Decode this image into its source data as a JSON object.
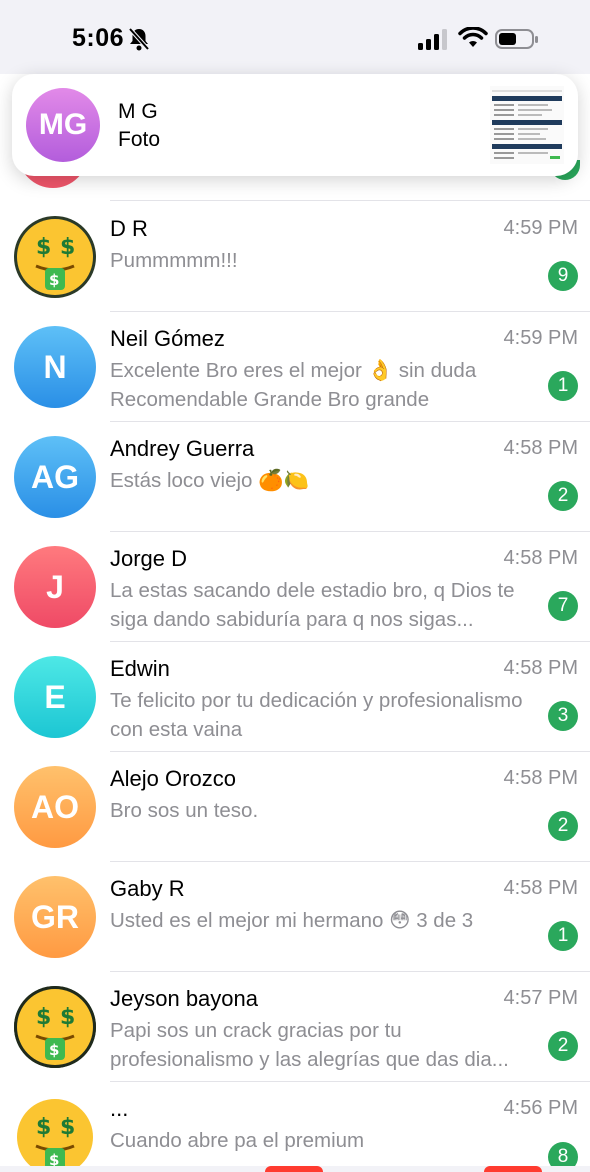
{
  "status_bar": {
    "time": "5:06"
  },
  "notification": {
    "avatar_initials": "MG",
    "sender": "M G",
    "text": "Foto"
  },
  "chats": [
    {
      "name": "D R",
      "time": "4:59 PM",
      "preview": "Pummmmm!!!",
      "unread": "9",
      "avatar_type": "emoji",
      "avatar_icon": "money-mouth-face-icon"
    },
    {
      "name": "Neil Gómez",
      "time": "4:59 PM",
      "preview": "Excelente Bro eres el mejor 👌 sin duda Recomendable Grande Bro grande",
      "unread": "1",
      "avatar_initials": "N",
      "avatar_color": "#2fa2ee"
    },
    {
      "name": "Andrey Guerra",
      "time": "4:58 PM",
      "preview": "Estás loco viejo 🍊🍋",
      "unread": "2",
      "avatar_initials": "AG",
      "avatar_color": "#2fa2ee"
    },
    {
      "name": "Jorge D",
      "time": "4:58 PM",
      "preview": "La estas sacando dele estadio bro, q Dios te siga dando sabiduría para q nos sigas...",
      "unread": "7",
      "avatar_initials": "J",
      "avatar_color": "#f25c6b"
    },
    {
      "name": "Edwin",
      "time": "4:58 PM",
      "preview": "Te felicito por tu dedicación y profesionalismo con esta vaina",
      "unread": "3",
      "avatar_initials": "E",
      "avatar_color": "#2fd8d8"
    },
    {
      "name": "Alejo Orozco",
      "time": "4:58 PM",
      "preview": "Bro sos un teso.",
      "unread": "2",
      "avatar_initials": "AO",
      "avatar_color": "#ffaa52"
    },
    {
      "name": "Gaby R",
      "time": "4:58 PM",
      "preview": "Usted es el mejor mi hermano 😳 3 de 3",
      "unread": "1",
      "avatar_initials": "GR",
      "avatar_color": "#ffaa52"
    },
    {
      "name": "Jeyson bayona",
      "time": "4:57 PM",
      "preview": "Papi sos un crack gracias por tu profesionalismo y las alegrías que das dia...",
      "unread": "2",
      "avatar_type": "emoji",
      "avatar_icon": "money-mouth-face-icon"
    },
    {
      "name": "...",
      "time": "4:56 PM",
      "preview": "Cuando abre pa el premium",
      "unread": "8",
      "avatar_type": "emoji",
      "avatar_icon": "money-mouth-face-icon"
    }
  ]
}
